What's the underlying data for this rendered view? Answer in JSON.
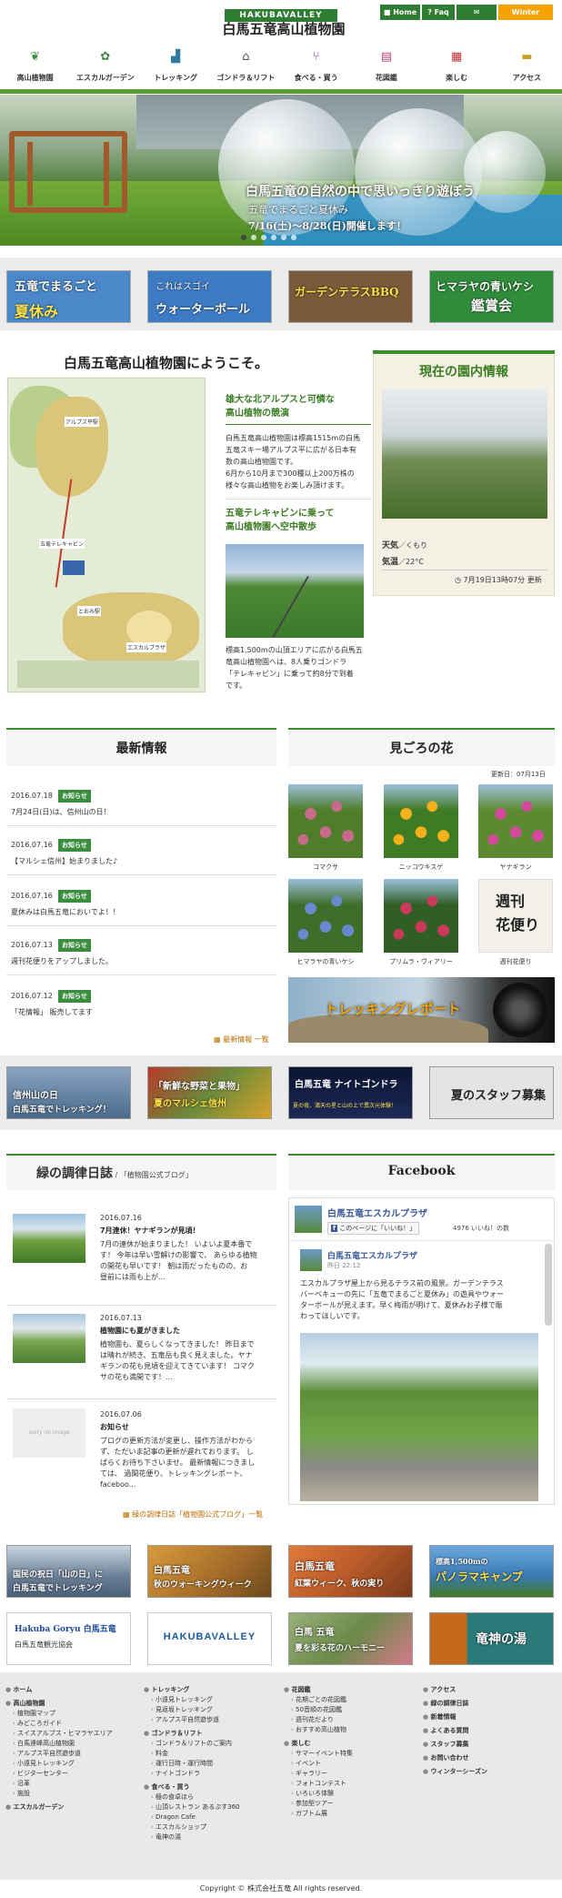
{
  "header": {
    "brand_top": "HAKUBAVALLEY",
    "brand_main": "白馬五竜高山植物園",
    "topbar": [
      {
        "label": "Home",
        "color": "#2e7d32"
      },
      {
        "label": "Faq",
        "color": "#2e7d32"
      },
      {
        "label": "Contact",
        "color": "#2e7d32"
      },
      {
        "label": "Winter Season",
        "color": "#f5a300"
      }
    ],
    "nav": [
      "高山植物園",
      "エスカルガーデン",
      "トレッキング",
      "ゴンドラ＆リフト",
      "食べる・買う",
      "花図鑑",
      "楽しむ",
      "アクセス"
    ]
  },
  "hero": {
    "caption1": "白馬五竜の自然の中で思いっきり遊ぼう",
    "caption2": "五竜でまるごと夏休み",
    "caption3": "7/16(土)～8/28(日)開催します！"
  },
  "banners": [
    {
      "l1": "五竜でまるごと",
      "l2": "夏休み",
      "bg": "#4a88c9"
    },
    {
      "l1": "これはスゴイ",
      "l2": "ウォーターボール",
      "bg": "#3d7bc5"
    },
    {
      "l1": "ガーデンテラス",
      "l2": "BBQ",
      "bg": "#7a5a3a"
    },
    {
      "l1": "ヒマラヤの青いケシ",
      "l2": "鑑賞会",
      "bg": "#2f8c3a"
    }
  ],
  "welcome": {
    "title": "白馬五竜高山植物園にようこそ。",
    "h1": "雄大な北アルプスと可憐な",
    "h1b": "高山植物の競演",
    "p1": [
      "白馬五竜高山植物園は標高1515mの白馬",
      "五竜スキー場アルプス平に広がる日本有",
      "数の高山植物園です。",
      "6月から10月まで300種以上200万株の",
      "様々な高山植物をお楽しみ頂けます。"
    ],
    "h2": "五竜テレキャビンに乗って",
    "h2b": "高山植物園へ空中散歩",
    "p2": [
      "標高1,500mの山頂エリアに広がる白馬五",
      "竜高山植物園へは、8人乗りゴンドラ",
      "「テレキャビン」に乗って約8分で到着",
      "です。"
    ],
    "map_labels": [
      "アルプス平駅",
      "五竜テレキャビン",
      "とおみ駅",
      "エスカルプラザ"
    ]
  },
  "current": {
    "title": "現在の園内情報",
    "weather_label": "天気",
    "weather_value": "／くもり",
    "temp_label": "気温",
    "temp_value": "／22°C",
    "updated": "7月19日13時07分 更新"
  },
  "news": {
    "title": "最新情報",
    "items": [
      {
        "date": "2016.07.18",
        "tag": "お知らせ",
        "text": "7月24日(日)は、信州山の日！"
      },
      {
        "date": "2016.07.16",
        "tag": "お知らせ",
        "text": "【マルシェ信州】始まりました♪"
      },
      {
        "date": "2016.07.16",
        "tag": "お知らせ",
        "text": "夏休みは白馬五竜においでよ！！"
      },
      {
        "date": "2016.07.13",
        "tag": "お知らせ",
        "text": "週刊花便りをアップしました。"
      },
      {
        "date": "2016.07.12",
        "tag": "お知らせ",
        "text": "「花情報」 販売してます"
      }
    ],
    "more": "最新情報 一覧"
  },
  "flowers": {
    "title": "見ごろの花",
    "updated": "更新日：07月13日",
    "items": [
      {
        "name": "コマクサ",
        "c1": "#c86a8a",
        "c2": "#4f7d2a"
      },
      {
        "name": "ニッコウキスゲ",
        "c1": "#f2b21b",
        "c2": "#3f7a25"
      },
      {
        "name": "ヤナギラン",
        "c1": "#d24a9c",
        "c2": "#5c8a30"
      },
      {
        "name": "ヒマラヤの青いケシ",
        "c1": "#6a88d0",
        "c2": "#3d6e2a"
      },
      {
        "name": "プリムラ・ヴィアリー",
        "c1": "#c93a5a",
        "c2": "#2f5f25"
      },
      {
        "name": "週刊花便り",
        "c1": "#f3f0ea",
        "c2": "#dcd7cc"
      }
    ],
    "weekly_l1": "週刊",
    "weekly_l2": "花便り",
    "trek": "トレッキングレポート"
  },
  "midbanners": [
    {
      "l1": "信州山の日",
      "l2": "白馬五竜でトレッキング！",
      "bg": "#4a6a8a"
    },
    {
      "l1": "「新鮮な野菜と果物」",
      "l2": "夏のマルシェ信州",
      "bg": "#6a8a3a"
    },
    {
      "l1": "白馬五竜 ナイトゴンドラ",
      "l2": "夏の夜、満天の星と山の上で異次元体験！",
      "bg": "#1c2a55"
    },
    {
      "l1": "夏のスタッフ募集",
      "l2": "",
      "bg": "#d8d8d8"
    }
  ],
  "blog": {
    "title": "緑の調律日誌",
    "subtitle": "「植物園公式ブログ」",
    "items": [
      {
        "date": "2016.07.16",
        "title": "7月連休！ヤナギランが見頃！",
        "lines": [
          "7月の連休が始まりました！ いよいよ夏本番で",
          "す！ 今年は早い雪解けの影響で、 あらゆる植物",
          "の開花も早いです！ 朝は雨だったものの、お",
          "昼前には雨も上が..."
        ]
      },
      {
        "date": "2016.07.13",
        "title": "植物園にも夏がきました",
        "lines": [
          "植物園も、夏らしくなってきました！ 昨日まで",
          "は晴れが続き、五竜岳も良く見えました。ヤナ",
          "ギランの花も見頃を迎えてきています！ コマク",
          "サの花も満開です！..."
        ]
      },
      {
        "date": "2016.07.06",
        "title": "お知らせ",
        "lines": [
          "ブログの更新方法が変更し、操作方法がわから",
          "ず、ただいま記事の更新が遅れております。 し",
          "ばらくお待ち下さいませ。 最新情報につきまし",
          "ては、 過間花便り、トレッキングレポート、",
          "faceboo..."
        ]
      }
    ],
    "noimage": "sorry no image",
    "more": "緑の調律日誌「植物園公式ブログ」一覧"
  },
  "facebook": {
    "title": "Facebook",
    "page_name": "白馬五竜エスカルプラザ",
    "like_button": "このページに「いいね！」",
    "like_count": "4976 いいね！の数",
    "post_name": "白馬五竜エスカルプラザ",
    "post_time": "昨日 22:12",
    "post_text": [
      "エスカルプラザ屋上から見るテラス前の風景。ガーデンテラス",
      "バーベキューの先に「五竜でまるごと夏休み」の遊具やウォー",
      "ターボールが見えます。早く梅雨が明けて、夏休みお子様で賑",
      "わってほしいです。"
    ]
  },
  "bottombanners": [
    {
      "l1": "国民の祝日「山の日」に",
      "l2": "白馬五竜でトレッキング",
      "bg": "#4a5f7a"
    },
    {
      "l1": "白馬五竜",
      "l2": "秋のウォーキングウィーク",
      "bg": "#a26a2a"
    },
    {
      "l1": "白馬五竜",
      "l2": "紅葉ウィーク、秋の実り",
      "bg": "#b85a2a"
    },
    {
      "l1": "標高1,500mの",
      "l2": "パノラマキャンプ",
      "bg": "#3a7ab5"
    },
    {
      "l1": "Hakuba Goryu 白馬五竜",
      "l2": "白馬五竜観光協会",
      "bg": "#ffffff"
    },
    {
      "l1": "HAKUBAVALLEY",
      "l2": "",
      "bg": "#ffffff"
    },
    {
      "l1": "白馬 五竜",
      "l2": "夏を彩る花のハーモニー",
      "bg": "#6a8a4a"
    },
    {
      "l1": "竜神の湯",
      "l2": "",
      "bg": "#2a7a7a"
    }
  ],
  "footer": {
    "col1": [
      {
        "t": "ホーム",
        "h": true
      },
      {
        "t": "高山植物園",
        "h": true
      },
      {
        "t": "植物園マップ",
        "h": false
      },
      {
        "t": "みどころガイド",
        "h": false
      },
      {
        "t": "スイスアルプス・ヒマラヤエリア",
        "h": false
      },
      {
        "t": "白馬連峰高山植物園",
        "h": false
      },
      {
        "t": "アルプス平自然遊歩道",
        "h": false
      },
      {
        "t": "小遠見トレッキング",
        "h": false
      },
      {
        "t": "ビジターセンター",
        "h": false
      },
      {
        "t": "沿革",
        "h": false
      },
      {
        "t": "施設",
        "h": false
      },
      {
        "t": "エスカルガーデン",
        "h": true
      }
    ],
    "col2": [
      {
        "t": "トレッキング",
        "h": true
      },
      {
        "t": "小遠見トレッキング",
        "h": false
      },
      {
        "t": "見返坂トレッキング",
        "h": false
      },
      {
        "t": "アルプス平自然遊歩道",
        "h": false
      },
      {
        "t": "ゴンドラ＆リフト",
        "h": true
      },
      {
        "t": "ゴンドラ＆リフトのご案内",
        "h": false
      },
      {
        "t": "料金",
        "h": false
      },
      {
        "t": "運行日時・運行時間",
        "h": false
      },
      {
        "t": "ナイトゴンドラ",
        "h": false
      },
      {
        "t": "食べる・買う",
        "h": true
      },
      {
        "t": "極の食卓ほら",
        "h": false
      },
      {
        "t": "山頂レストラン あるぷす360",
        "h": false
      },
      {
        "t": "Dragon Cafe",
        "h": false
      },
      {
        "t": "エスカルショップ",
        "h": false
      },
      {
        "t": "竜神の湯",
        "h": false
      }
    ],
    "col3": [
      {
        "t": "花図鑑",
        "h": true
      },
      {
        "t": "花期ごとの花図鑑",
        "h": false
      },
      {
        "t": "50音順の花図鑑",
        "h": false
      },
      {
        "t": "週刊花だより",
        "h": false
      },
      {
        "t": "おすすめ高山植物",
        "h": false
      },
      {
        "t": "楽しむ",
        "h": true
      },
      {
        "t": "サマーイベント特集",
        "h": false
      },
      {
        "t": "イベント",
        "h": false
      },
      {
        "t": "ギャラリー",
        "h": false
      },
      {
        "t": "フォトコンテスト",
        "h": false
      },
      {
        "t": "いろいろ体験",
        "h": false
      },
      {
        "t": "参加型ツアー",
        "h": false
      },
      {
        "t": "ガブトム展",
        "h": false
      }
    ],
    "col4": [
      {
        "t": "アクセス",
        "h": true
      },
      {
        "t": "緑の調律日誌",
        "h": true
      },
      {
        "t": "新着情報",
        "h": true
      },
      {
        "t": "よくある質問",
        "h": true
      },
      {
        "t": "スタッフ募集",
        "h": true
      },
      {
        "t": "お問い合わせ",
        "h": true
      },
      {
        "t": "ウィンターシーズン",
        "h": true
      }
    ],
    "copyright": "Copyright © 株式会社五竜 All rights reserved."
  },
  "colors": {
    "accent": "#3b8e3f",
    "topbar": "#2e7d32",
    "winter": "#f5a300",
    "link": "#b86e00"
  },
  "icons": {
    "nav": [
      "leaf-icon",
      "flower-icon",
      "boot-icon",
      "gondola-icon",
      "cutlery-icon",
      "book-icon",
      "calendar-icon",
      "car-icon"
    ]
  }
}
